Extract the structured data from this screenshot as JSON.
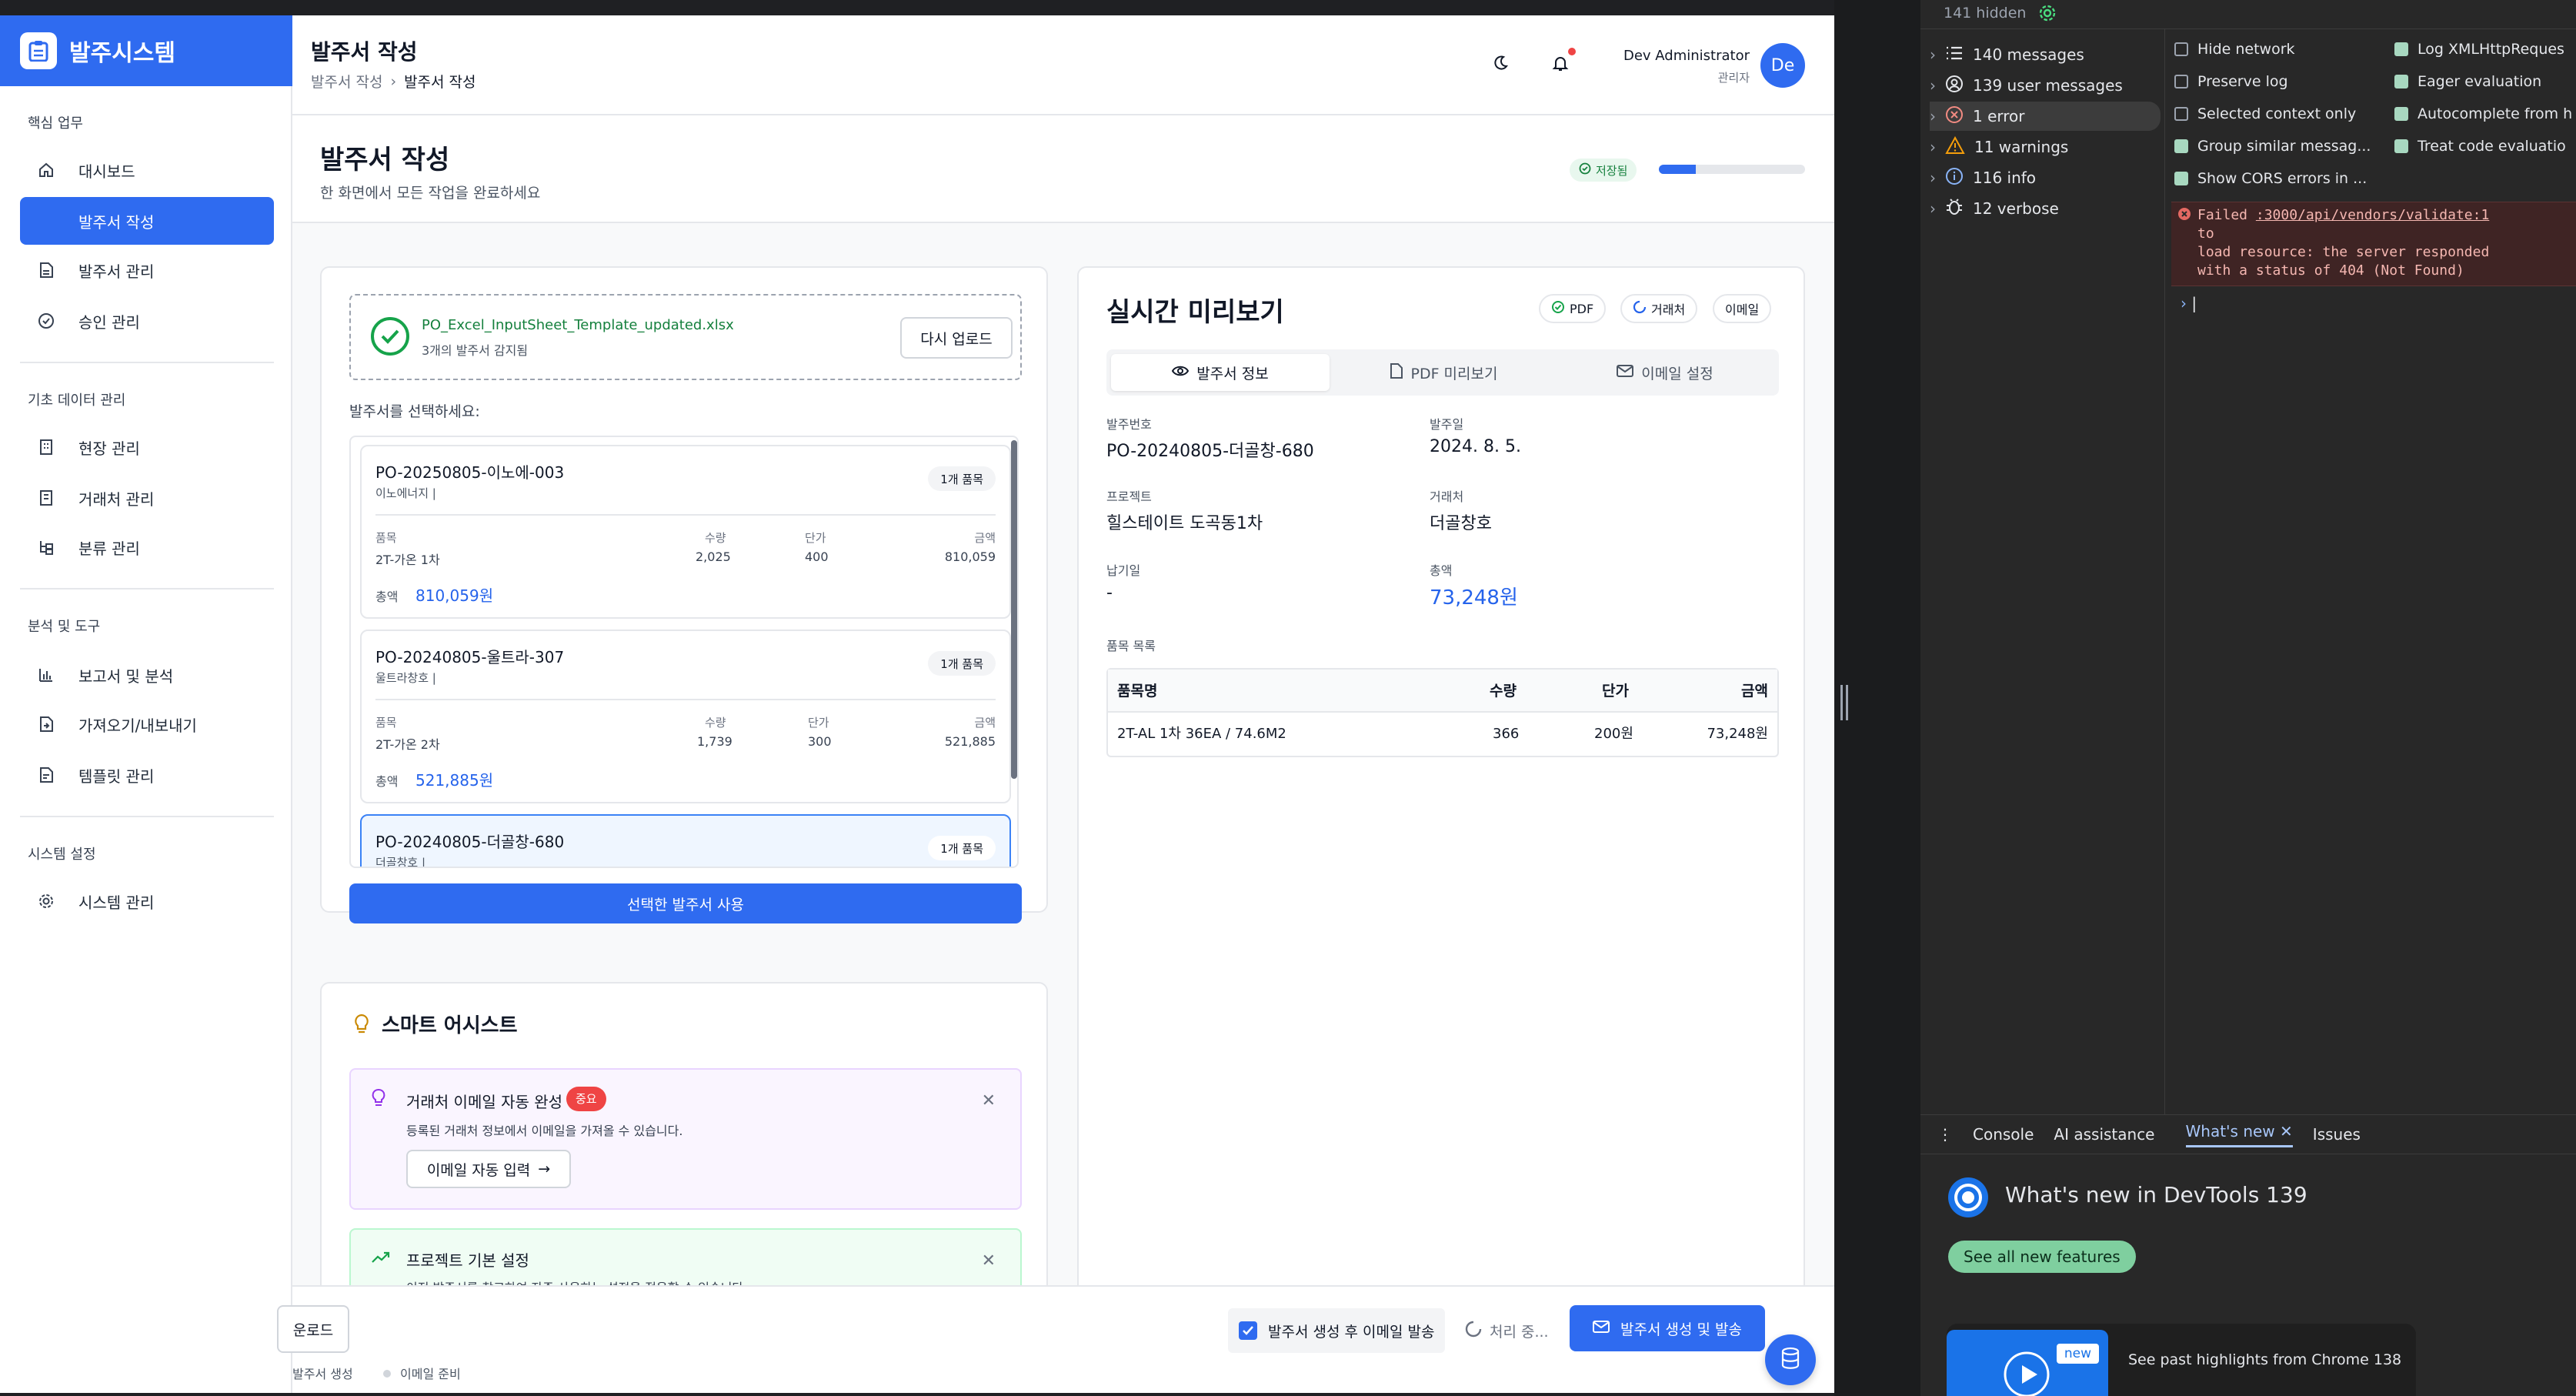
{
  "app": {
    "logo_text": "발주시스템",
    "brand_color": "#2f6bf0"
  },
  "sidebar": {
    "groups": [
      {
        "title": "핵심 업무",
        "items": [
          {
            "label": "대시보드",
            "icon": "home-icon"
          },
          {
            "label": "발주서 작성",
            "icon": "edit-icon",
            "active": true
          },
          {
            "label": "발주서 관리",
            "icon": "file-icon"
          },
          {
            "label": "승인 관리",
            "icon": "check-circle-icon"
          }
        ]
      },
      {
        "title": "기초 데이터 관리",
        "items": [
          {
            "label": "현장 관리",
            "icon": "building-icon"
          },
          {
            "label": "거래처 관리",
            "icon": "building-icon"
          },
          {
            "label": "분류 관리",
            "icon": "hierarchy-icon"
          }
        ]
      },
      {
        "title": "분석 및 도구",
        "items": [
          {
            "label": "보고서 및 분석",
            "icon": "bar-chart-icon"
          },
          {
            "label": "가져오기/내보내기",
            "icon": "file-import-icon"
          },
          {
            "label": "템플릿 관리",
            "icon": "template-icon"
          }
        ]
      },
      {
        "title": "시스템 설정",
        "items": [
          {
            "label": "시스템 관리",
            "icon": "gear-icon"
          }
        ]
      }
    ]
  },
  "topbar": {
    "title": "발주서 작성",
    "breadcrumb": [
      "발주서 작성",
      "발주서 작성"
    ],
    "user_name": "Dev Administrator",
    "user_role": "관리자",
    "avatar_initials": "De"
  },
  "page": {
    "title": "발주서 작성",
    "subtitle": "한 화면에서 모든 작업을 완료하세요",
    "saved_label": "저장됨",
    "progress": 0.25
  },
  "upload": {
    "file_name": "PO_Excel_InputSheet_Template_updated.xlsx",
    "detected": "3개의 발주서 감지됨",
    "reupload_label": "다시 업로드",
    "select_prompt": "발주서를 선택하세요:",
    "use_selected_label": "선택한 발주서 사용"
  },
  "po_list": [
    {
      "po_no": "PO-20250805-이노에-003",
      "vendor": "이노에너지 |",
      "badge": "1개 품목",
      "h_item": "품목",
      "h_qty": "수량",
      "h_price": "단가",
      "h_amount": "금액",
      "item": "2T-가온 1차",
      "qty": "2,025",
      "price": "400",
      "amount": "810,059",
      "total_label": "총액",
      "total": "810,059원"
    },
    {
      "po_no": "PO-20240805-울트라-307",
      "vendor": "울트라창호 |",
      "badge": "1개 품목",
      "h_item": "품목",
      "h_qty": "수량",
      "h_price": "단가",
      "h_amount": "금액",
      "item": "2T-가온 2차",
      "qty": "1,739",
      "price": "300",
      "amount": "521,885",
      "total_label": "총액",
      "total": "521,885원"
    },
    {
      "po_no": "PO-20240805-더골창-680",
      "vendor": "더골창호 |",
      "badge": "1개 품목",
      "h_item": "",
      "h_qty": "",
      "h_price": "",
      "h_amount": "",
      "item": "",
      "qty": "",
      "price": "",
      "amount": "",
      "total_label": "",
      "total": "",
      "selected": true
    }
  ],
  "assist": {
    "title": "스마트 어시스트",
    "card1": {
      "title": "거래처 이메일 자동 완성",
      "badge": "중요",
      "desc": "등록된 거래처 정보에서 이메일을 가져올 수 있습니다.",
      "action": "이메일 자동 입력"
    },
    "card2": {
      "title": "프로젝트 기본 설정",
      "desc": "이전 발주서를 참고하여 자주 사용하는 설정을 적용할 수 있습니다."
    }
  },
  "preview": {
    "title": "실시간 미리보기",
    "chips": [
      "PDF",
      "거래처",
      "이메일"
    ],
    "tabs": [
      "발주서 정보",
      "PDF 미리보기",
      "이메일 설정"
    ],
    "fields": {
      "po_no_label": "발주번호",
      "po_no": "PO-20240805-더골창-680",
      "date_label": "발주일",
      "date": "2024. 8. 5.",
      "project_label": "프로젝트",
      "project": "힐스테이트 도곡동1차",
      "vendor_label": "거래처",
      "vendor": "더골창호",
      "due_label": "납기일",
      "due": "-",
      "total_label": "총액",
      "total": "73,248원"
    },
    "items_label": "품목 목록",
    "table_headers": [
      "품목명",
      "수량",
      "단가",
      "금액"
    ],
    "table_rows": [
      [
        "2T-AL 1차 36EA / 74.6M2",
        "366",
        "200원",
        "73,248원"
      ]
    ]
  },
  "bottombar": {
    "download_label": "운로드",
    "step1": "발주서 생성",
    "step2": "이메일 준비",
    "email_checkbox": "발주서 생성 후 이메일 발송",
    "processing": "처리 중...",
    "submit": "발주서 생성 및 발송"
  },
  "devtools": {
    "hidden": "141 hidden",
    "sidebar": [
      {
        "label": "140 messages",
        "icon": "list-icon"
      },
      {
        "label": "139 user messages",
        "icon": "user-icon"
      },
      {
        "label": "1 error",
        "icon": "error-icon"
      },
      {
        "label": "11 warnings",
        "icon": "warning-icon"
      },
      {
        "label": "116 info",
        "icon": "info-icon"
      },
      {
        "label": "12 verbose",
        "icon": "bug-icon"
      }
    ],
    "options_left": [
      {
        "label": "Hide network",
        "checked": false
      },
      {
        "label": "Preserve log",
        "checked": false
      },
      {
        "label": "Selected context only",
        "checked": false
      },
      {
        "label": "Group similar messag...",
        "checked": true
      },
      {
        "label": "Show CORS errors in ...",
        "checked": true
      }
    ],
    "options_right": [
      {
        "label": "Log XMLHttpReques",
        "checked": true
      },
      {
        "label": "Eager evaluation",
        "checked": true
      },
      {
        "label": "Autocomplete from h",
        "checked": true
      },
      {
        "label": "Treat code evaluatio",
        "checked": true
      }
    ],
    "error_prefix": "Failed ",
    "error_link": ":3000/api/vendors/validate:1",
    "error_l2": "to",
    "error_l3": "load resource: the server responded",
    "error_l4": "with a status of 404 (Not Found)",
    "tabs": [
      "Console",
      "AI assistance",
      "What's new",
      "Issues"
    ],
    "whatsnew_title": "What's new in DevTools 139",
    "see_all": "See all new features",
    "new_badge": "new",
    "highlights": "See past highlights from Chrome 138"
  }
}
